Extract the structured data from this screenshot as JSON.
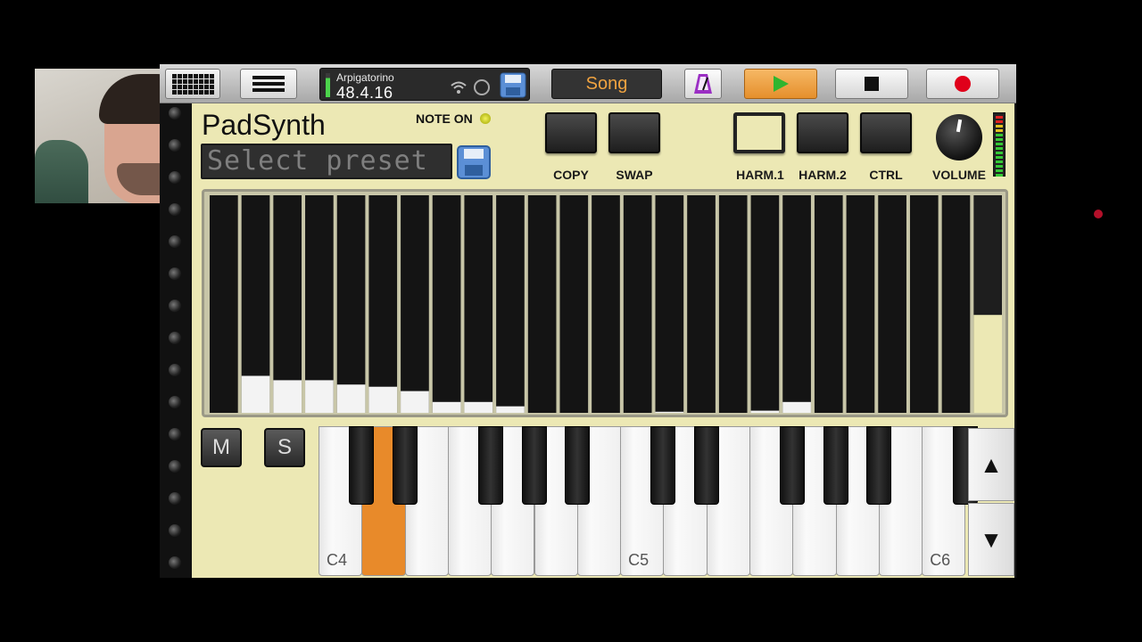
{
  "topbar": {
    "grid_icon": "grid-icon",
    "menu_icon": "hamburger-icon",
    "song_name": "Arpigatorino",
    "version": "48.4.16",
    "wifi_icon": "wifi-icon",
    "midi_icon": "midi-icon",
    "save_icon": "floppy-icon",
    "song_label": "Song",
    "metronome_icon": "metronome-icon",
    "play_icon": "play-icon",
    "stop_icon": "stop-icon",
    "record_icon": "record-icon",
    "colors": {
      "play": "#e8962f",
      "record": "#e0001a",
      "song_text": "#f0a340"
    }
  },
  "synth": {
    "title": "PadSynth",
    "note_on_label": "NOTE ON",
    "preset": "Select preset",
    "buttons": [
      {
        "label": "COPY",
        "lit": false
      },
      {
        "label": "SWAP",
        "lit": false
      },
      {
        "label": "HARM.1",
        "lit": true
      },
      {
        "label": "HARM.2",
        "lit": false
      },
      {
        "label": "CTRL",
        "lit": false
      },
      {
        "label": "VOLUME",
        "lit": false
      }
    ],
    "ms_buttons": [
      "M",
      "S"
    ],
    "harmonics_levels": [
      0,
      0.17,
      0.15,
      0.15,
      0.13,
      0.12,
      0.1,
      0.05,
      0.05,
      0.03,
      0,
      0,
      0,
      0,
      0.005,
      0,
      0,
      0.01,
      0.05,
      0,
      0,
      0,
      0,
      0,
      0.45
    ],
    "selected_harmonic": 24,
    "colors": {
      "panel": "#ece8b4",
      "bar_fill": "#f3f3f3",
      "selected_fill": "#ece8b4"
    }
  },
  "keyboard": {
    "labels": [
      "C4",
      "C5",
      "C6"
    ],
    "pressed_key": "C#4",
    "pressed_color": "#e88a2a",
    "octave_up_icon": "triangle-up-icon",
    "octave_down_icon": "triangle-down-icon",
    "up_glyph": "▲",
    "down_glyph": "▼"
  }
}
